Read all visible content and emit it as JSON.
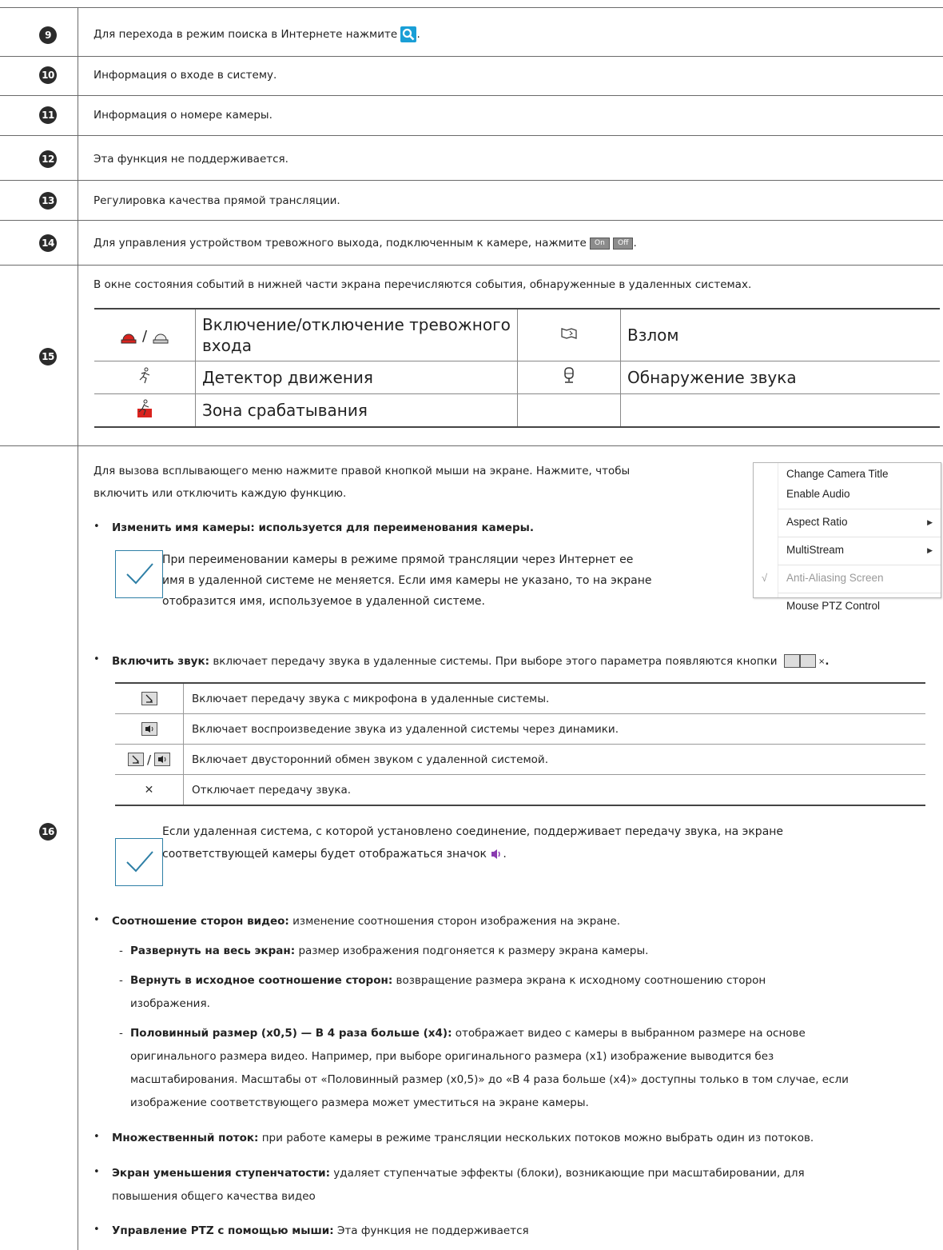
{
  "rows": {
    "r9": {
      "num": "9",
      "text": "Для перехода в режим поиска в Интернете нажмите",
      "after": "."
    },
    "r10": {
      "num": "10",
      "text": "Информация о входе в систему."
    },
    "r11": {
      "num": "11",
      "text": "Информация о номере камеры."
    },
    "r12": {
      "num": "12",
      "text": "Эта функция не поддерживается."
    },
    "r13": {
      "num": "13",
      "text": "Регулировка качества прямой трансляции."
    },
    "r14": {
      "num": "14",
      "text": "Для управления устройством тревожного выхода, подключенным к камере, нажмите",
      "on": "On",
      "off": "Off",
      "after": "."
    },
    "r15": {
      "num": "15",
      "text": "В окне состояния событий в нижней части экрана перечисляются события, обнаруженные в удаленных системах."
    },
    "r16": {
      "num": "16"
    }
  },
  "events": {
    "alarm_label_1": "Включение/отключение тревожного",
    "alarm_label_2": "входа",
    "alarm_sep": "/",
    "tamper": "Взлом",
    "motion": "Детектор движения",
    "audio_detect": "Обнаружение звука",
    "trip_zone": "Зона срабатывания"
  },
  "section16": {
    "intro_1": "Для вызова всплывающего меню нажмите правой кнопкой мыши на экране. Нажмите, чтобы",
    "intro_2": "включить или отключить каждую функцию.",
    "rename_bold": "Изменить имя камеры: используется для переименования камеры.",
    "note1_1": "При переименовании камеры в режиме прямой трансляции через Интернет ее",
    "note1_2": "имя в удаленной системе не меняется. Если имя камеры не указано, то на экране",
    "note1_3": "отобразится имя, используемое в удаленной системе.",
    "audio_bold": "Включить звук:",
    "audio_text": "включает передачу звука в удаленные системы. При выборе этого параметра появляются кнопки",
    "audio_after": ".",
    "audio_rows": [
      {
        "text": "Включает передачу звука с микрофона в удаленные системы."
      },
      {
        "text": "Включает воспроизведение звука из удаленной системы через динамики."
      },
      {
        "text": "Включает двусторонний обмен звуком с удаленной системой."
      },
      {
        "text": "Отключает передачу звука."
      }
    ],
    "mic_spk_sep": "/",
    "x_glyph": "✕",
    "note2_1": "Если удаленная система, с которой установлено соединение, поддерживает передачу звука, на экране",
    "note2_2": "соответствующей камеры будет отображаться значок",
    "note2_after": ".",
    "aspect_bold": "Соотношение сторон видео:",
    "aspect_text": "изменение соотношения сторон изображения на экране.",
    "fit_bold": "Развернуть на весь экран:",
    "fit_text": "размер изображения подгоняется к размеру экрана камеры.",
    "orig_bold": "Вернуть в исходное соотношение сторон:",
    "orig_text": "возвращение размера экрана к исходному соотношению сторон",
    "orig_text2": "изображения.",
    "half_bold": "Половинный размер (x0,5) — В 4 раза больше (x4):",
    "half_text": "отображает видео с камеры в выбранном размере на основе",
    "half_text2": "оригинального размера видео. Например, при выборе оригинального размера (x1) изображение выводится без",
    "half_text3": "масштабирования. Масштабы от «Половинный размер (x0,5)» до «В 4 раза больше (x4)» доступны только в том случае, если",
    "half_text4": "изображение соответствующего размера может уместиться на экране камеры.",
    "multi_bold": "Множественный поток:",
    "multi_text": "при работе камеры в режиме трансляции нескольких потоков можно выбрать один из потоков.",
    "aa_bold": "Экран уменьшения ступенчатости:",
    "aa_text": "удаляет ступенчатые эффекты (блоки), возникающие при масштабировании, для",
    "aa_text2": "повышения общего качества видео",
    "ptz_bold": "Управление PTZ с помощью мыши:",
    "ptz_text": "Эта функция не поддерживается",
    "bullet": "•",
    "dash": "-"
  },
  "menu": {
    "items": [
      "Change Camera Title",
      "Enable Audio",
      "Aspect Ratio",
      "MultiStream",
      "Anti-Aliasing Screen",
      "Mouse PTZ Control"
    ],
    "arrow": "▶",
    "check": "√"
  },
  "colors": {
    "accent": "#2e7fa6",
    "search": "#1a9fd6",
    "alarm_red": "#d9231e"
  }
}
